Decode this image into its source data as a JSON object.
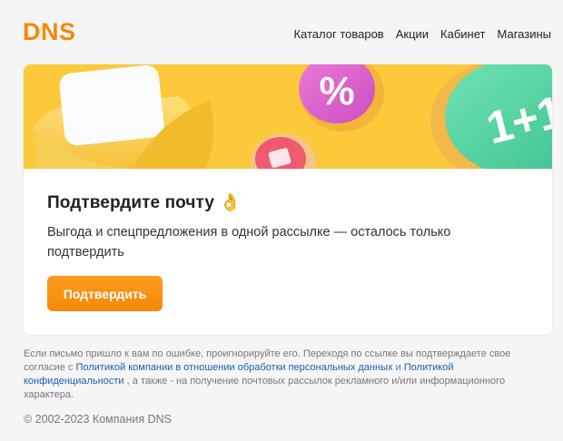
{
  "header": {
    "logo_text": "DNS",
    "nav": [
      {
        "label": "Каталог товаров"
      },
      {
        "label": "Акции"
      },
      {
        "label": "Кабинет"
      },
      {
        "label": "Магазины"
      }
    ]
  },
  "card": {
    "title": "Подтвердите почту 👌",
    "text": "Выгода и спецпредложения в одной рассылке — осталось только подтвердить",
    "button_label": "Подтвердить",
    "banner": {
      "badge_percent": "%",
      "badge_promo": "1+1"
    }
  },
  "footer": {
    "note_part1": "Если письмо пришло к вам по ошибке, проигнорируйте его. Переходя по ссылке вы подтверждаете свое согласие с ",
    "link_policy": "Политикой компании в отношении обработки персональных данных",
    "note_and": " и ",
    "link_privacy": "Политикой конфиденциальности",
    "note_part2": " , а также - на получение почтовых рассылок рекламного и/или информационного характера.",
    "copyright": "© 2002-2023 Компания DNS"
  },
  "colors": {
    "brand_orange": "#f38a08",
    "banner_yellow": "#fcc93a",
    "link_blue": "#1a5fb4"
  }
}
